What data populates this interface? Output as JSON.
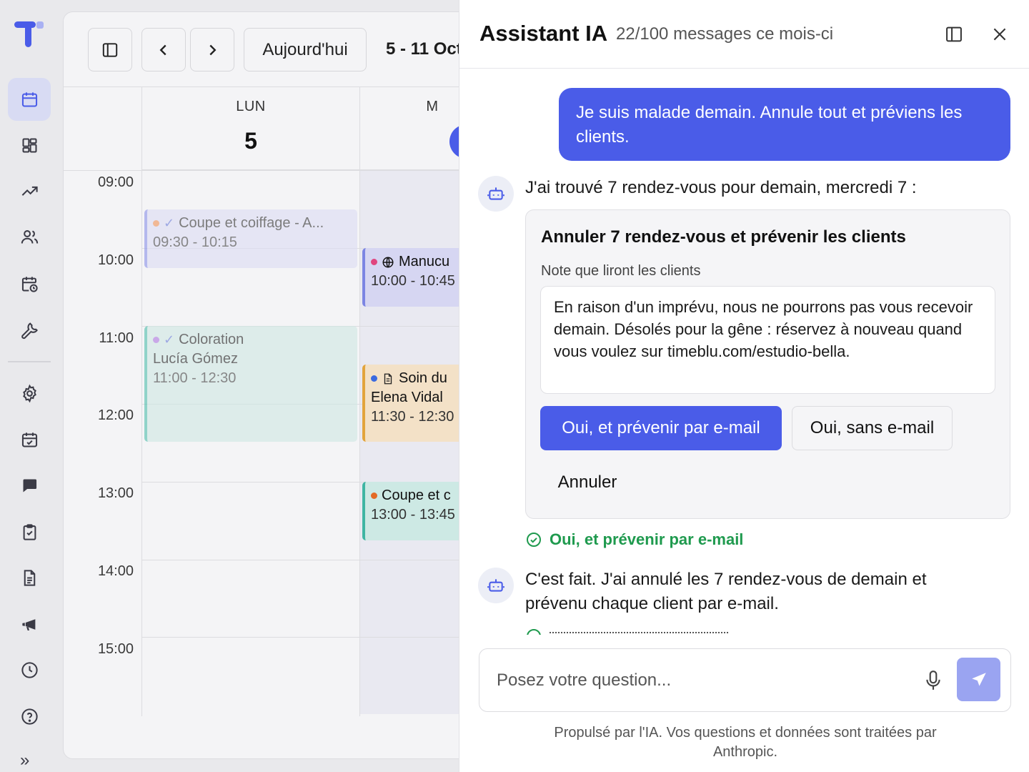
{
  "rail": {
    "items": [
      {
        "icon": "calendar-icon",
        "active": true
      },
      {
        "icon": "dashboard-grid-icon"
      },
      {
        "icon": "trending-up-icon"
      },
      {
        "icon": "users-icon"
      },
      {
        "icon": "calendar-clock-icon"
      },
      {
        "icon": "wrench-icon"
      },
      {
        "icon": "gear-icon"
      },
      {
        "icon": "calendar-check-icon"
      },
      {
        "icon": "chat-bubble-icon"
      },
      {
        "icon": "clipboard-check-icon"
      },
      {
        "icon": "document-icon"
      },
      {
        "icon": "megaphone-icon"
      },
      {
        "icon": "clock-icon"
      },
      {
        "icon": "help-circle-icon"
      }
    ],
    "expand_label": "»",
    "accent": "#4a5ce8"
  },
  "calendar": {
    "today_label": "Aujourd'hui",
    "range_label": "5 - 11 Oct",
    "days": [
      {
        "name": "LUN",
        "num": "5"
      },
      {
        "name": "M",
        "num": ""
      }
    ],
    "times": [
      "09:00",
      "10:00",
      "11:00",
      "12:00",
      "13:00",
      "14:00",
      "15:00"
    ],
    "events": [
      {
        "title": "Coupe et coiffage - A...",
        "time": "09:30 - 10:15",
        "client": "",
        "dot": "#f0955a",
        "bg": "#dcdcf3",
        "border": "#8e95e8"
      },
      {
        "title": "Coloration",
        "client": "Lucía Gómez",
        "time": "11:00 - 12:30",
        "dot": "#b07be0",
        "bg": "#cfe8e3",
        "border": "#54bfae"
      },
      {
        "title": "Manucu",
        "time": "10:00 - 10:45",
        "client": "",
        "dot": "#e0457f",
        "bg": "#d6d6f2",
        "border": "#7c85e3"
      },
      {
        "title": "Soin du",
        "client": "Elena Vidal",
        "time": "11:30 - 12:30",
        "dot": "#3b6ae0",
        "bg": "#f3e1c7",
        "border": "#e2a43c"
      },
      {
        "title": "Coupe et c",
        "time": "13:00 - 13:45",
        "client": "",
        "dot": "#e36a25",
        "bg": "#cde9e4",
        "border": "#3fb5a3"
      }
    ]
  },
  "assistant": {
    "title": "Assistant IA",
    "quota": "22/100 messages ce mois-ci",
    "user_message": "Je suis malade demain. Annule tout et préviens les clients.",
    "bot_message_1": "J'ai trouvé 7 rendez-vous pour demain, mercredi 7 :",
    "card": {
      "title": "Annuler 7 rendez-vous et prévenir les clients",
      "note_label": "Note que liront les clients",
      "note_text": "En raison d'un imprévu, nous ne pourrons pas vous recevoir demain. Désolés pour la gêne : réservez à nouveau quand vous voulez sur timeblu.com/estudio-bella.",
      "btn_primary": "Oui, et prévenir par e-mail",
      "btn_secondary": "Oui, sans e-mail",
      "btn_cancel": "Annuler"
    },
    "confirmation": "Oui, et prévenir par e-mail",
    "bot_message_2": "C'est fait. J'ai annulé les 7 rendez-vous de demain et prévenu chaque client par e-mail.",
    "composer_placeholder": "Posez votre question...",
    "footer": "Propulsé par l'IA. Vos questions et données sont traitées par Anthropic.",
    "success_color": "#1f9a4e"
  }
}
